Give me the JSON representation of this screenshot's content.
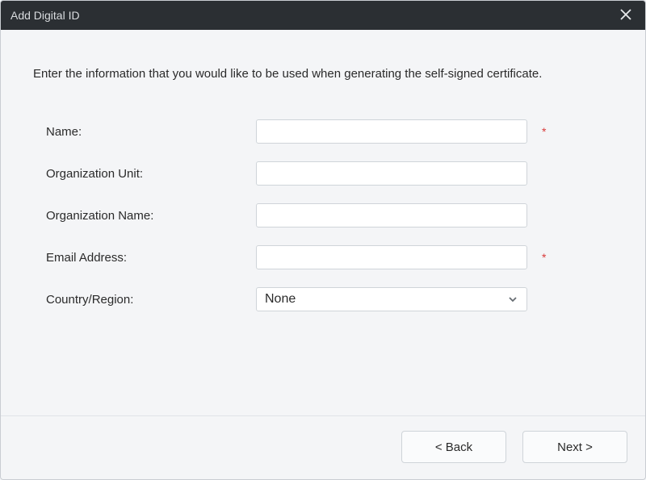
{
  "window": {
    "title": "Add Digital ID"
  },
  "instruction": "Enter the information that you would like to be used when generating the self-signed certificate.",
  "form": {
    "name": {
      "label": "Name:",
      "value": "",
      "required_marker": "*"
    },
    "orgUnit": {
      "label": "Organization Unit:",
      "value": ""
    },
    "orgName": {
      "label": "Organization Name:",
      "value": ""
    },
    "email": {
      "label": "Email Address:",
      "value": "",
      "required_marker": "*"
    },
    "country": {
      "label": "Country/Region:",
      "selected": "None"
    }
  },
  "buttons": {
    "back": "< Back",
    "next": "Next >"
  }
}
